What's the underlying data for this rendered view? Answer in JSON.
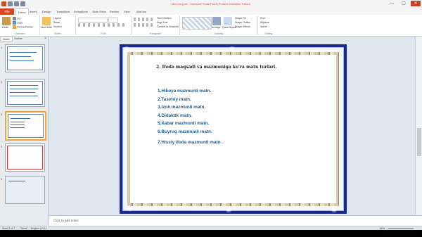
{
  "window": {
    "title": "Ma'ruza.pptx - Microsoft PowerPoint (Product Activation Failed)",
    "minimize": "—",
    "maximize": "▢",
    "close": "✕"
  },
  "ribbon_tabs": {
    "file": "File",
    "tabs": [
      "Home",
      "Insert",
      "Design",
      "Transitions",
      "Animations",
      "Slide Show",
      "Review",
      "View",
      "Add-Ins"
    ]
  },
  "ribbon": {
    "clipboard": {
      "label": "Clipboard",
      "paste": "Paste",
      "cut": "Cut",
      "copy": "Copy",
      "format_painter": "Format Painter"
    },
    "slides": {
      "label": "Slides",
      "new_slide": "New Slide",
      "layout": "Layout",
      "reset": "Reset",
      "section": "Section"
    },
    "font": {
      "label": "Font"
    },
    "paragraph": {
      "label": "Paragraph",
      "text_direction": "Text Direction",
      "align_text": "Align Text",
      "convert": "Convert to SmartArt"
    },
    "drawing": {
      "label": "Drawing",
      "arrange": "Arrange",
      "quick_styles": "Quick Styles",
      "shape_fill": "Shape Fill",
      "shape_outline": "Shape Outline",
      "shape_effects": "Shape Effects"
    },
    "editing": {
      "label": "Editing",
      "find": "Find",
      "replace": "Replace",
      "select": "Select"
    }
  },
  "left_pane": {
    "tab_slides": "Slides",
    "tab_outline": "Outline",
    "close": "×",
    "slide_numbers": [
      "1",
      "2",
      "3",
      "4",
      "5"
    ]
  },
  "slide": {
    "title": "2. Ifoda maqsadi va mazmuniga ko'ra matn turlari.",
    "items": [
      "1.Hikoya mazmunli matn.",
      "2.Tasviriy matn.",
      "3.Izoh mazmunli matn.",
      "4.Didaktik matn.",
      "5.Xabar mazmunli matn.",
      "6.Buyruq mazmunli matn."
    ],
    "last_item": "7.Hissiy ifoda mazmunli matn ."
  },
  "notes": {
    "placeholder": "Click to add notes"
  },
  "status_bar": {
    "slide_info": "Slide 3 of 7",
    "theme": "\"Tema\"",
    "language": "English (U.S.)",
    "zoom": "65%"
  },
  "colors": {
    "file_tab": "#d24726",
    "slide_border": "#1a2a8c",
    "list_text": "#1f5a8c",
    "selected_thumb": "#f0a830"
  }
}
